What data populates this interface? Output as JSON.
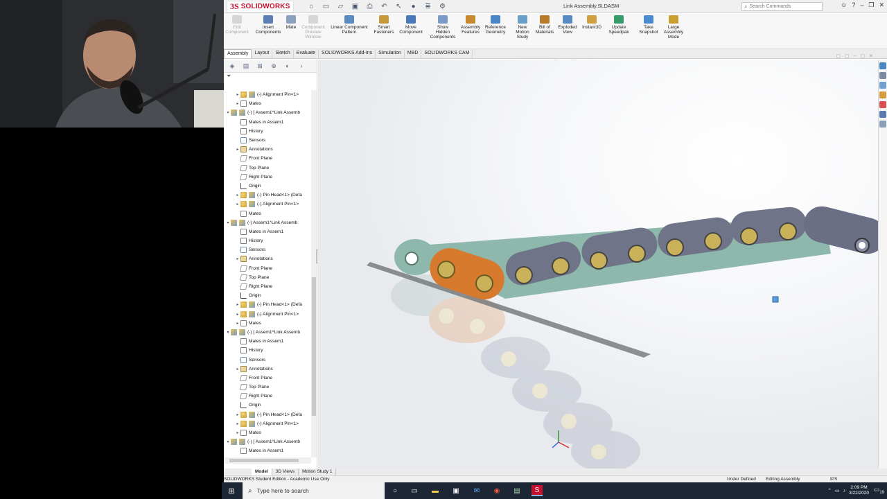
{
  "titlebar": {
    "logo_text": "SOLIDWORKS",
    "logo_ds": "3S",
    "document_title": "Link Assembly.SLDASM",
    "search_placeholder": "Search Commands",
    "help_label": "?"
  },
  "ribbon": {
    "buttons": [
      {
        "label": "Edit\nComponent",
        "disabled": true
      },
      {
        "label": "Insert\nComponents",
        "disabled": false
      },
      {
        "label": "Mate",
        "disabled": false
      },
      {
        "label": "Component\nPreview\nWindow",
        "disabled": true
      },
      {
        "label": "Linear Component\nPattern",
        "disabled": false
      },
      {
        "label": "Smart\nFasteners",
        "disabled": false
      },
      {
        "label": "Move\nComponent",
        "disabled": false
      },
      {
        "label": "Show\nHidden\nComponents",
        "disabled": false
      },
      {
        "label": "Assembly\nFeatures",
        "disabled": false
      },
      {
        "label": "Reference\nGeometry",
        "disabled": false
      },
      {
        "label": "New\nMotion\nStudy",
        "disabled": false
      },
      {
        "label": "Bill of\nMaterials",
        "disabled": false
      },
      {
        "label": "Exploded\nView",
        "disabled": false
      },
      {
        "label": "Instant3D",
        "disabled": false
      },
      {
        "label": "Update\nSpeedpak",
        "disabled": false
      },
      {
        "label": "Take\nSnapshot",
        "disabled": false
      },
      {
        "label": "Large\nAssembly\nMode",
        "disabled": false
      }
    ]
  },
  "command_manager_tabs": [
    "Assembly",
    "Layout",
    "Sketch",
    "Evaluate",
    "SOLIDWORKS Add-Ins",
    "Simulation",
    "MBD",
    "SOLIDWORKS CAM"
  ],
  "active_tab": "Assembly",
  "tree": [
    {
      "depth": 2,
      "expand": "▸",
      "icon": "comp",
      "label": "(-) Alignment Pin<1>"
    },
    {
      "depth": 2,
      "expand": "▸",
      "icon": "mate",
      "label": "Mates"
    },
    {
      "depth": 1,
      "expand": "▾",
      "icon": "asm",
      "label": "(-) [ Assem1^Link Assemb"
    },
    {
      "depth": 2,
      "expand": "",
      "icon": "mate",
      "label": "Mates in Assem1"
    },
    {
      "depth": 2,
      "expand": "",
      "icon": "hist",
      "label": "History"
    },
    {
      "depth": 2,
      "expand": "",
      "icon": "sensor",
      "label": "Sensors"
    },
    {
      "depth": 2,
      "expand": "▸",
      "icon": "annot",
      "label": "Annotations"
    },
    {
      "depth": 2,
      "expand": "",
      "icon": "plane",
      "label": "Front Plane"
    },
    {
      "depth": 2,
      "expand": "",
      "icon": "plane",
      "label": "Top Plane"
    },
    {
      "depth": 2,
      "expand": "",
      "icon": "plane",
      "label": "Right Plane"
    },
    {
      "depth": 2,
      "expand": "",
      "icon": "origin",
      "label": "Origin"
    },
    {
      "depth": 2,
      "expand": "▸",
      "icon": "comp",
      "label": "(-) Pin Head<1> (Defa"
    },
    {
      "depth": 2,
      "expand": "▸",
      "icon": "comp",
      "label": "(-) Alignment Pin<1>"
    },
    {
      "depth": 2,
      "expand": "",
      "icon": "mate",
      "label": "Mates"
    },
    {
      "depth": 1,
      "expand": "▾",
      "icon": "asm",
      "label": "(-) Assem1^Link Assemb"
    },
    {
      "depth": 2,
      "expand": "",
      "icon": "mate",
      "label": "Mates in Assem1"
    },
    {
      "depth": 2,
      "expand": "",
      "icon": "hist",
      "label": "History"
    },
    {
      "depth": 2,
      "expand": "",
      "icon": "sensor",
      "label": "Sensors"
    },
    {
      "depth": 2,
      "expand": "▸",
      "icon": "annot",
      "label": "Annotations"
    },
    {
      "depth": 2,
      "expand": "",
      "icon": "plane",
      "label": "Front Plane"
    },
    {
      "depth": 2,
      "expand": "",
      "icon": "plane",
      "label": "Top Plane"
    },
    {
      "depth": 2,
      "expand": "",
      "icon": "plane",
      "label": "Right Plane"
    },
    {
      "depth": 2,
      "expand": "",
      "icon": "origin",
      "label": "Origin"
    },
    {
      "depth": 2,
      "expand": "▸",
      "icon": "comp",
      "label": "(-) Pin Head<1> (Defa"
    },
    {
      "depth": 2,
      "expand": "▸",
      "icon": "comp",
      "label": "(-) Alignment Pin<1>"
    },
    {
      "depth": 2,
      "expand": "▸",
      "icon": "mate",
      "label": "Mates"
    },
    {
      "depth": 1,
      "expand": "▾",
      "icon": "asm",
      "label": "(-) [ Assem1^Link Assemb"
    },
    {
      "depth": 2,
      "expand": "",
      "icon": "mate",
      "label": "Mates in Assem1"
    },
    {
      "depth": 2,
      "expand": "",
      "icon": "hist",
      "label": "History"
    },
    {
      "depth": 2,
      "expand": "",
      "icon": "sensor",
      "label": "Sensors"
    },
    {
      "depth": 2,
      "expand": "▸",
      "icon": "annot",
      "label": "Annotations"
    },
    {
      "depth": 2,
      "expand": "",
      "icon": "plane",
      "label": "Front Plane"
    },
    {
      "depth": 2,
      "expand": "",
      "icon": "plane",
      "label": "Top Plane"
    },
    {
      "depth": 2,
      "expand": "",
      "icon": "plane",
      "label": "Right Plane"
    },
    {
      "depth": 2,
      "expand": "",
      "icon": "origin",
      "label": "Origin"
    },
    {
      "depth": 2,
      "expand": "▸",
      "icon": "comp",
      "label": "(-) Pin Head<1> (Defa"
    },
    {
      "depth": 2,
      "expand": "▸",
      "icon": "comp",
      "label": "(-) Alignment Pin<1>"
    },
    {
      "depth": 2,
      "expand": "▸",
      "icon": "mate",
      "label": "Mates"
    },
    {
      "depth": 1,
      "expand": "▾",
      "icon": "asm",
      "label": "(-) [ Assem1^Link Assemb"
    },
    {
      "depth": 2,
      "expand": "",
      "icon": "mate",
      "label": "Mates in Assem1"
    }
  ],
  "bottom_tabs": [
    "Model",
    "3D Views",
    "Motion Study 1"
  ],
  "active_bottom_tab": "Model",
  "status": {
    "edition": "SOLIDWORKS Student Edition - Academic Use Only",
    "definition": "Under Defined",
    "mode": "Editing Assembly",
    "units": "IPS"
  },
  "taskbar": {
    "search_placeholder": "Type here to search",
    "time": "2:09 PM",
    "date": "3/22/2020",
    "notification_count": "19"
  },
  "colors": {
    "link_orange": "#d87a2e",
    "link_gray": "#6f7488",
    "link_teal": "#8fb8ac",
    "pin_gold": "#c9b25a",
    "brand_red": "#c8102e"
  }
}
